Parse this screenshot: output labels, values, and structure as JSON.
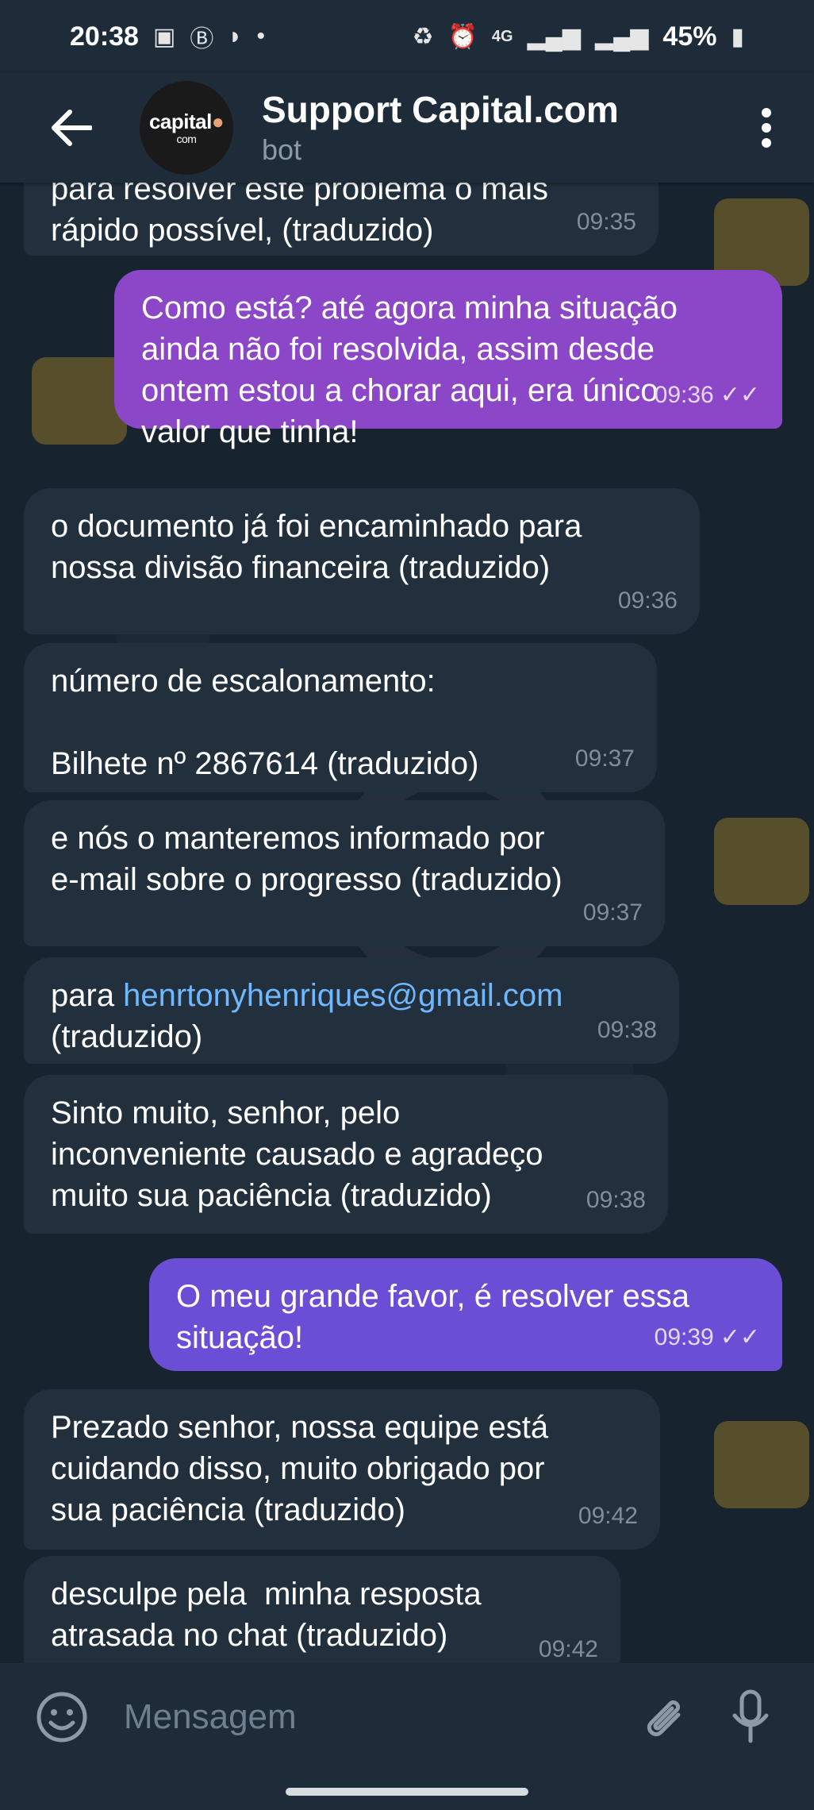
{
  "status_bar": {
    "time": "20:38",
    "dot": "•",
    "network": "4G",
    "battery": "45%"
  },
  "header": {
    "title": "Support Capital.com",
    "subtitle": "bot",
    "avatar_text": "capital",
    "avatar_sub": "com"
  },
  "messages": [
    {
      "text": "para resolver este problema o mais\nrápido possível, (traduzido)",
      "time": "09:35",
      "dir": "in"
    },
    {
      "text": "Como está? até agora minha situação\nainda não foi resolvida, assim desde\nontem estou a chorar aqui, era único\nvalor que tinha!",
      "time": "09:36",
      "dir": "out",
      "status": "✓✓"
    },
    {
      "text": "o documento já foi encaminhado para\nnossa divisão financeira (traduzido)",
      "time": "09:36",
      "dir": "in"
    },
    {
      "text": "número de escalonamento:\n\nBilhete nº 2867614 (traduzido)",
      "time": "09:37",
      "dir": "in"
    },
    {
      "text": "e nós o manteremos informado por\ne-mail sobre o progresso (traduzido)",
      "time": "09:37",
      "dir": "in"
    },
    {
      "prefix": "para ",
      "link": "henrtonyhenriques@gmail.com",
      "suffix": "(traduzido)",
      "time": "09:38",
      "dir": "in"
    },
    {
      "text": "Sinto muito, senhor, pelo\ninconveniente causado e agradeço\nmuito sua paciência (traduzido)",
      "time": "09:38",
      "dir": "in"
    },
    {
      "text": "O meu grande favor, é resolver essa\nsituação!",
      "time": "09:39",
      "dir": "out",
      "status": "✓✓"
    },
    {
      "text": "Prezado senhor, nossa equipe está\ncuidando disso, muito obrigado por\nsua paciência (traduzido)",
      "time": "09:42",
      "dir": "in"
    },
    {
      "text": "desculpe pela  minha resposta\natrasada no chat (traduzido)",
      "time": "09:42",
      "dir": "in"
    }
  ],
  "input": {
    "placeholder": "Mensagem"
  },
  "colors": {
    "incoming_bubble": "#222f3d",
    "outgoing_bubble": "#7a43c4",
    "link": "#6fb7ff",
    "header_bg": "#1e2c3a"
  },
  "icons": [
    "back-arrow-icon",
    "more-vert-icon",
    "emoji-icon",
    "attach-icon",
    "mic-icon"
  ]
}
